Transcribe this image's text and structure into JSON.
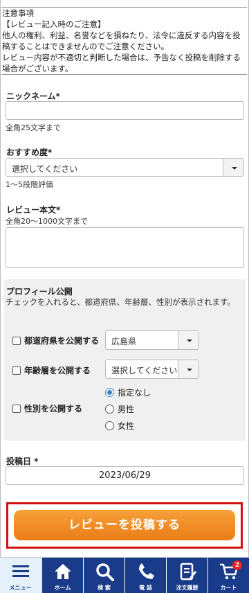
{
  "notice": {
    "lines": [
      "注意事項",
      "【レビュー記入時のご注意】",
      "他人の権利、利益、名誉などを損ねたり、法令に違反する内容を投稿することはできませんのでご注意ください。",
      "レビュー内容が不適切と判断した場合は、予告なく投稿を削除する場合がございます。"
    ]
  },
  "nickname": {
    "label": "ニックネーム*",
    "value": "",
    "hint": "全角25文字まで"
  },
  "rating": {
    "label": "おすすめ度*",
    "selected": "選択してください",
    "hint": "1〜5段階評価"
  },
  "body": {
    "label": "レビュー本文*",
    "hint": "全角20〜1000文字まで",
    "value": ""
  },
  "profile": {
    "title": "プロフィール公開",
    "description": "チェックを入れると、都道府県、年齢層、性別が表示されます。",
    "prefecture": {
      "label": "都道府県を公開する",
      "checked": false,
      "selected": "広島県"
    },
    "age": {
      "label": "年齢層を公開する",
      "checked": false,
      "selected": "選択してください"
    },
    "gender": {
      "label": "性別を公開する",
      "checked": false,
      "options": [
        "指定なし",
        "男性",
        "女性"
      ],
      "selected": "指定なし"
    }
  },
  "post_date": {
    "label": "投稿日 *",
    "value": "2023/06/29"
  },
  "submit": {
    "label": "レビューを投稿する"
  },
  "tabbar": {
    "items": [
      {
        "label": "メニュー",
        "icon": "hamburger-menu-icon"
      },
      {
        "label": "ホーム",
        "icon": "home-icon"
      },
      {
        "label": "検 索",
        "icon": "search-icon"
      },
      {
        "label": "電 話",
        "icon": "phone-icon"
      },
      {
        "label": "注文履歴",
        "icon": "order-history-icon"
      },
      {
        "label": "カート",
        "icon": "cart-icon",
        "badge": "2"
      }
    ]
  },
  "colors": {
    "accent": "#ea7d17",
    "nav": "#1a3b8a",
    "highlight": "#d20f0f"
  }
}
